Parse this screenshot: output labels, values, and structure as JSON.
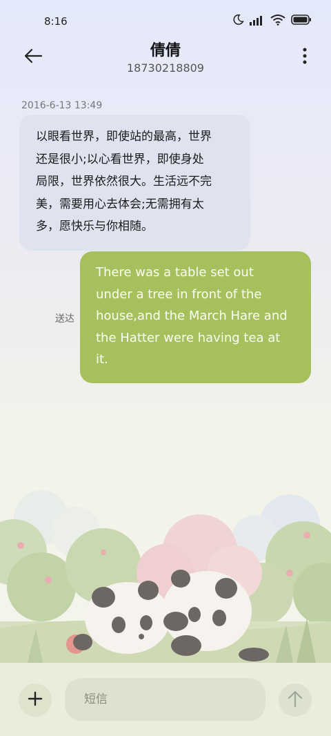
{
  "status_bar": {
    "time": "8:16",
    "icons": [
      "moon-icon",
      "signal-icon",
      "wifi-icon",
      "battery-icon"
    ]
  },
  "header": {
    "contact_name": "倩倩",
    "phone_number": "18730218809",
    "back_icon": "arrow-left-icon",
    "menu_icon": "more-vertical-icon"
  },
  "conversation": {
    "timestamp": "2016-6-13 13:49",
    "incoming": {
      "lines": [
        "以眼看世界，即使站的最高，世界",
        "还是很小;以心看世界，即使身处",
        "局限，世界依然很大。生活远不完",
        "美，需要用心去体会;无需拥有太",
        "多，愿快乐与你相随。"
      ]
    },
    "outgoing": {
      "lines": [
        "There was a table set out",
        "under a tree in front of the",
        "house,and the March Hare and",
        "the Hatter were having tea at",
        "it."
      ],
      "status": "送达"
    }
  },
  "composer": {
    "placeholder": "短信",
    "add_icon": "plus-icon",
    "send_icon": "arrow-up-icon"
  },
  "colors": {
    "incoming_bubble": "#dfe2ef",
    "outgoing_bubble": "#a6c05d",
    "composer_bg": "#e9eedc"
  }
}
